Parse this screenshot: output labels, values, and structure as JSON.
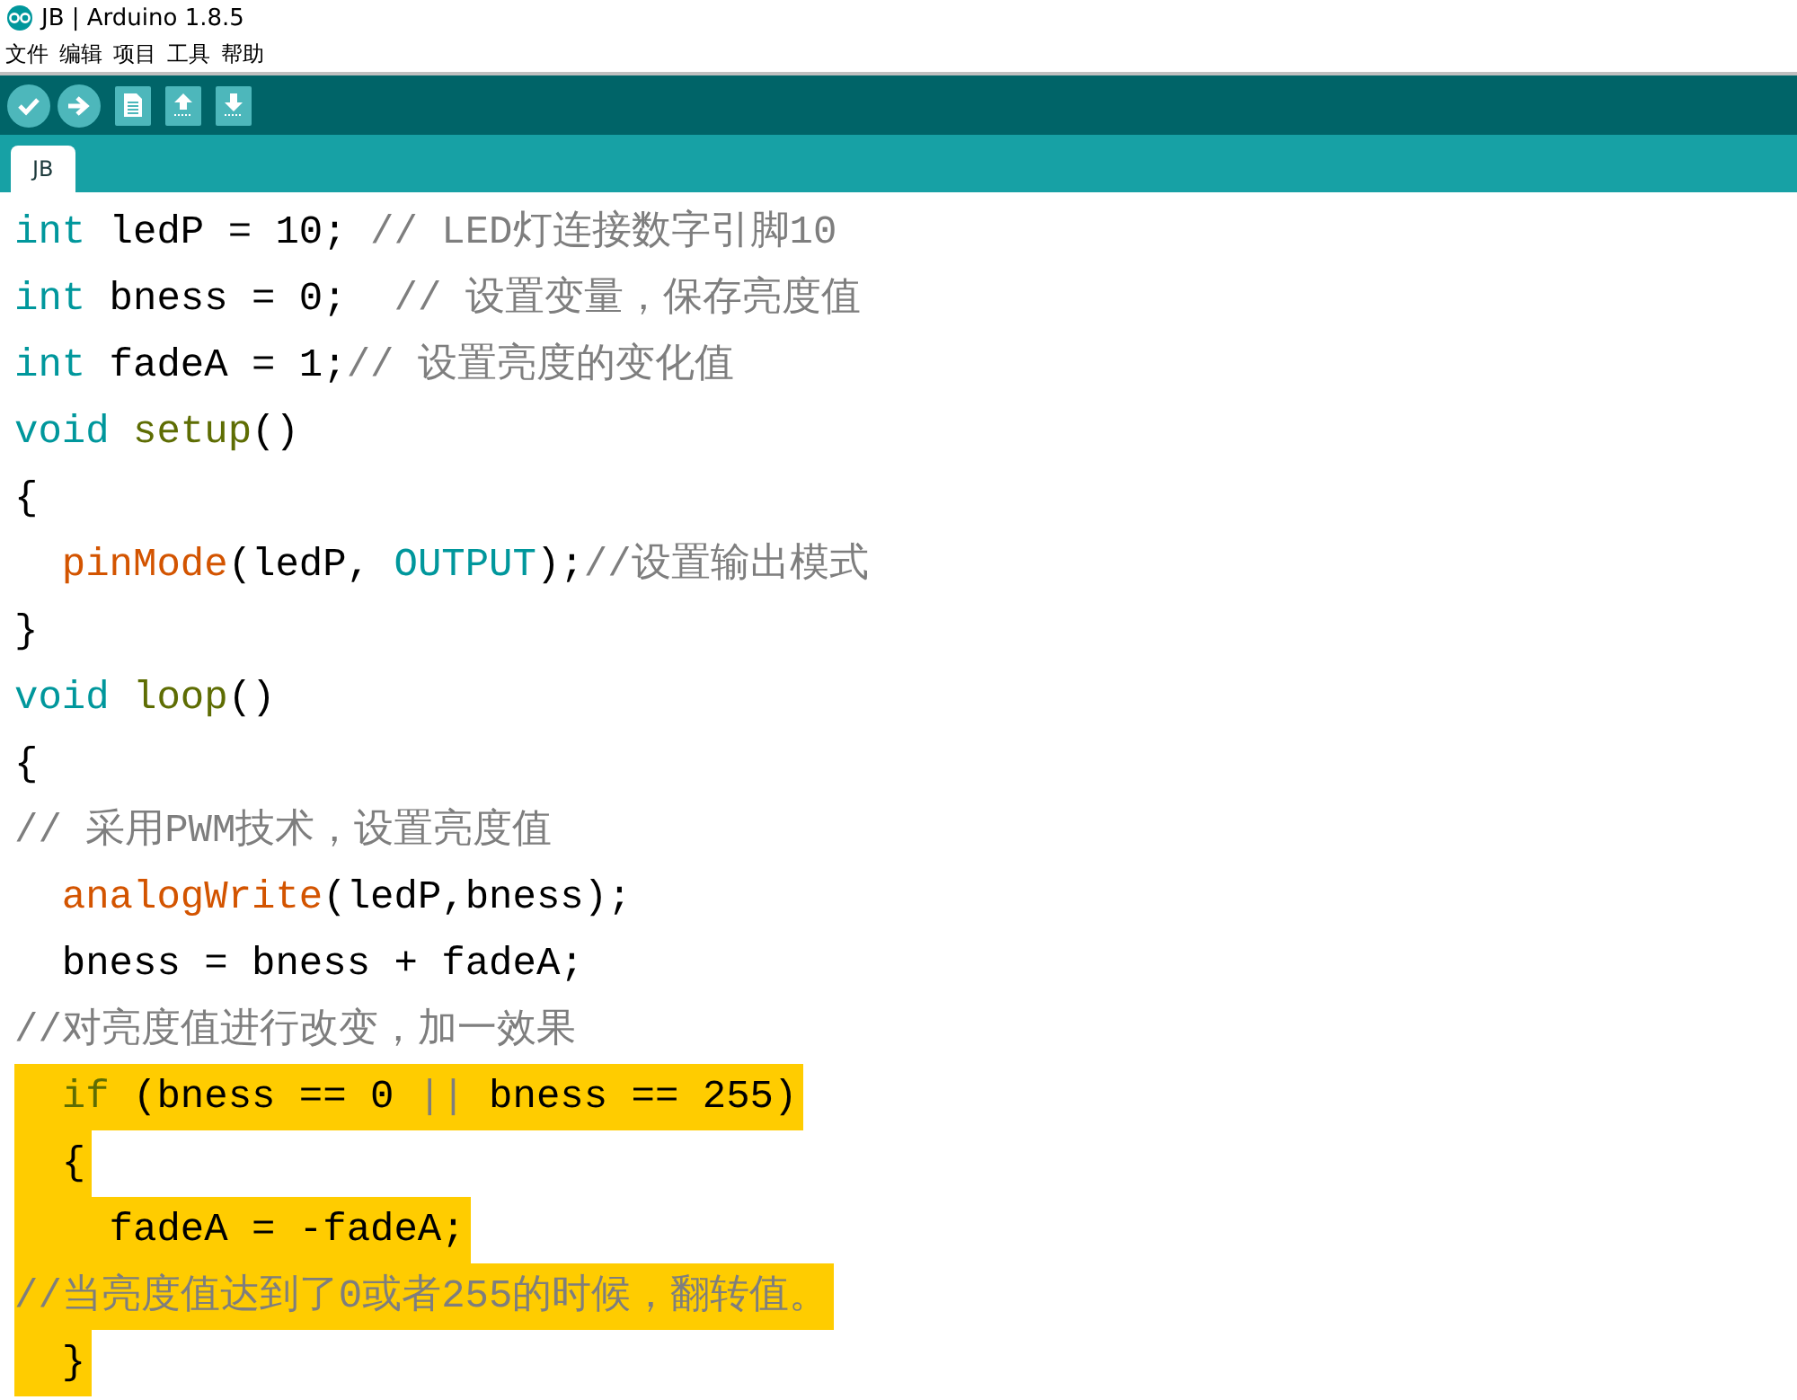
{
  "window": {
    "title": "JB | Arduino 1.8.5"
  },
  "menu": [
    "文件",
    "编辑",
    "项目",
    "工具",
    "帮助"
  ],
  "toolbar": [
    {
      "kind": "verify"
    },
    {
      "kind": "upload"
    },
    {
      "kind": "new"
    },
    {
      "kind": "open"
    },
    {
      "kind": "save"
    }
  ],
  "tabs": [
    {
      "label": "JB",
      "selected": true
    }
  ],
  "code_lines": [
    {
      "selected": false,
      "tokens": [
        {
          "kind": "type",
          "text": "int"
        },
        {
          "kind": "plain",
          "text": " ledP = 10; "
        },
        {
          "kind": "comment",
          "text": "// LED灯连接数字引脚10"
        }
      ]
    },
    {
      "selected": false,
      "tokens": [
        {
          "kind": "type",
          "text": "int"
        },
        {
          "kind": "plain",
          "text": " bness = 0;  "
        },
        {
          "kind": "comment",
          "text": "// 设置变量，保存亮度值"
        }
      ]
    },
    {
      "selected": false,
      "tokens": [
        {
          "kind": "type",
          "text": "int"
        },
        {
          "kind": "plain",
          "text": " fadeA = 1;"
        },
        {
          "kind": "comment",
          "text": "// 设置亮度的变化值"
        }
      ]
    },
    {
      "selected": false,
      "tokens": [
        {
          "kind": "type",
          "text": "void"
        },
        {
          "kind": "func",
          "text": " setup"
        },
        {
          "kind": "plain",
          "text": "()"
        }
      ]
    },
    {
      "selected": false,
      "tokens": [
        {
          "kind": "plain",
          "text": "{"
        }
      ]
    },
    {
      "selected": false,
      "tokens": [
        {
          "kind": "builtin",
          "text": "  pinMode"
        },
        {
          "kind": "plain",
          "text": "(ledP, "
        },
        {
          "kind": "type",
          "text": "OUTPUT"
        },
        {
          "kind": "plain",
          "text": ");"
        },
        {
          "kind": "comment",
          "text": "//设置输出模式"
        }
      ]
    },
    {
      "selected": false,
      "tokens": [
        {
          "kind": "plain",
          "text": "}"
        }
      ]
    },
    {
      "selected": false,
      "tokens": [
        {
          "kind": "type",
          "text": "void"
        },
        {
          "kind": "func",
          "text": " loop"
        },
        {
          "kind": "plain",
          "text": "()"
        }
      ]
    },
    {
      "selected": false,
      "tokens": [
        {
          "kind": "plain",
          "text": "{"
        }
      ]
    },
    {
      "selected": false,
      "tokens": [
        {
          "kind": "comment",
          "text": "// 采用PWM技术，设置亮度值"
        }
      ]
    },
    {
      "selected": false,
      "tokens": [
        {
          "kind": "builtin",
          "text": "  analogWrite"
        },
        {
          "kind": "plain",
          "text": "(ledP,bness);"
        }
      ]
    },
    {
      "selected": false,
      "tokens": [
        {
          "kind": "plain",
          "text": "  bness = bness + fadeA;"
        }
      ]
    },
    {
      "selected": false,
      "tokens": [
        {
          "kind": "comment",
          "text": "//对亮度值进行改变，加一效果"
        }
      ]
    },
    {
      "selected": true,
      "tokens": [
        {
          "kind": "func",
          "text": "  if"
        },
        {
          "kind": "plain",
          "text": " (bness == 0 "
        },
        {
          "kind": "comment",
          "text": "||"
        },
        {
          "kind": "plain",
          "text": " bness == 255)"
        }
      ]
    },
    {
      "selected": true,
      "tokens": [
        {
          "kind": "plain",
          "text": "  {"
        }
      ]
    },
    {
      "selected": true,
      "tokens": [
        {
          "kind": "plain",
          "text": "    fadeA = -fadeA;"
        }
      ]
    },
    {
      "selected": true,
      "tokens": [
        {
          "kind": "comment",
          "text": "//当亮度值达到了0或者255的时候，翻转值。"
        }
      ]
    },
    {
      "selected": true,
      "tokens": [
        {
          "kind": "plain",
          "text": "  }"
        }
      ]
    }
  ]
}
